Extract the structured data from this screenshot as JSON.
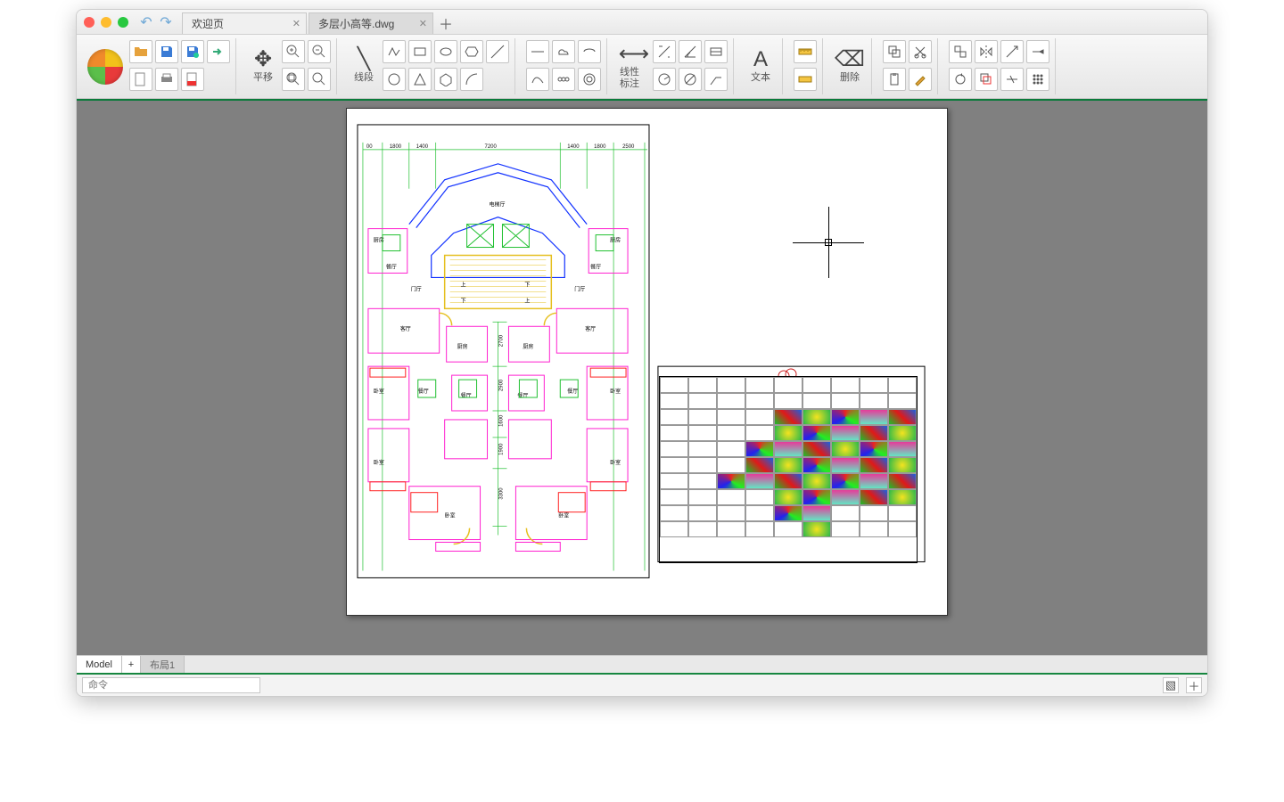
{
  "titlebar": {
    "tabs": [
      {
        "label": "欢迎页",
        "active": false
      },
      {
        "label": "多层小高等.dwg",
        "active": true
      }
    ]
  },
  "toolbar": {
    "pan_label": "平移",
    "line_group_label": "线段",
    "dim_group_label": "线性标注",
    "text_big": "A",
    "text_label": "文本",
    "delete_label": "删除"
  },
  "layout_tabs": {
    "model": "Model",
    "layout1": "布局1"
  },
  "statusbar": {
    "cmd_placeholder": "命令"
  },
  "drawing": {
    "top_dims": [
      "00",
      "1800",
      "1400",
      "7200",
      "1400",
      "1800",
      "2500"
    ],
    "center_dims": [
      "2700",
      "2900",
      "1600",
      "1900",
      "3300"
    ],
    "room_labels": {
      "top_hall": "电梯厅",
      "kitchen": "厨房",
      "dining": "餐厅",
      "foyer": "门厅",
      "up": "上",
      "down": "下",
      "living": "客厅",
      "dining2": "餐厅",
      "bedroom": "卧室"
    }
  }
}
